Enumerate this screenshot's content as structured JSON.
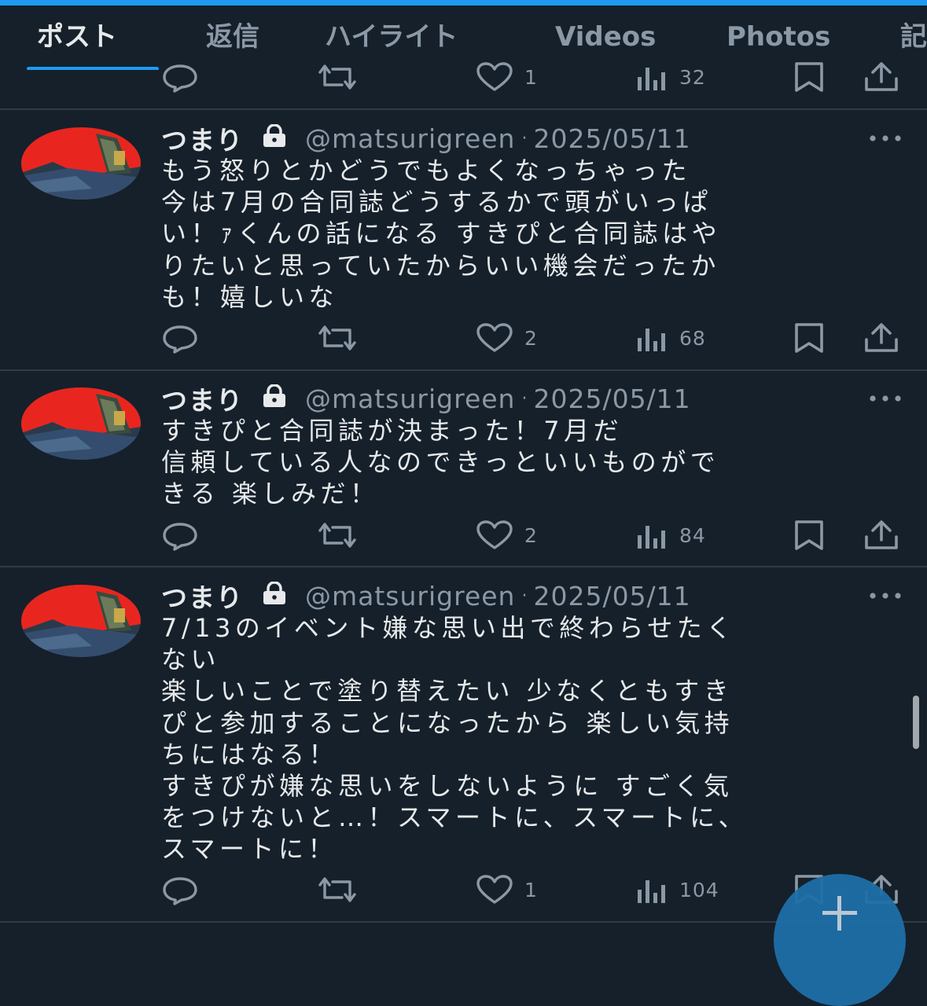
{
  "tabs": [
    {
      "label": "ポスト",
      "active": true
    },
    {
      "label": "返信"
    },
    {
      "label": "ハイライト"
    },
    {
      "label": "Videos"
    },
    {
      "label": "Photos"
    },
    {
      "label": "記"
    }
  ],
  "top_post_partial": {
    "likes": "1",
    "views": "32"
  },
  "posts": [
    {
      "name": "つまり",
      "handle": "@matsurigreen",
      "separator": "·",
      "date": "2025/05/11",
      "text": "もう怒りとかどうでもよくなっちゃった\n今は7月の合同誌どうするかで頭がいっぱ\nい！ｧくんの話になる すきぴと合同誌はや\nりたいと思っていたからいい機会だったか\nも！嬉しいな",
      "likes": "2",
      "views": "68"
    },
    {
      "name": "つまり",
      "handle": "@matsurigreen",
      "separator": "·",
      "date": "2025/05/11",
      "text": "すきぴと合同誌が決まった！7月だ\n信頼している人なのできっといいものがで\nきる 楽しみだ！",
      "likes": "2",
      "views": "84"
    },
    {
      "name": "つまり",
      "handle": "@matsurigreen",
      "separator": "·",
      "date": "2025/05/11",
      "text": "7/13のイベント嫌な思い出で終わらせたく\nない\n楽しいことで塗り替えたい 少なくともすき\nぴと参加することになったから 楽しい気持\nちにはなる！\nすきぴが嫌な思いをしないように すごく気\nをつけないと…！スマートに、スマートに、\nスマートに！",
      "likes": "1",
      "views": "104"
    }
  ],
  "icons": {
    "reply": "reply-icon",
    "retweet": "retweet-icon",
    "like": "heart-icon",
    "views": "views-icon",
    "bookmark": "bookmark-icon",
    "share": "share-icon",
    "lock": "lock-icon",
    "more": "more-icon",
    "compose": "plus-icon"
  },
  "colors": {
    "background": "#15202b",
    "accent": "#1d9bf0",
    "text": "#e7e9ea",
    "muted": "#8b98a5",
    "avatar_red": "#e8261f"
  }
}
